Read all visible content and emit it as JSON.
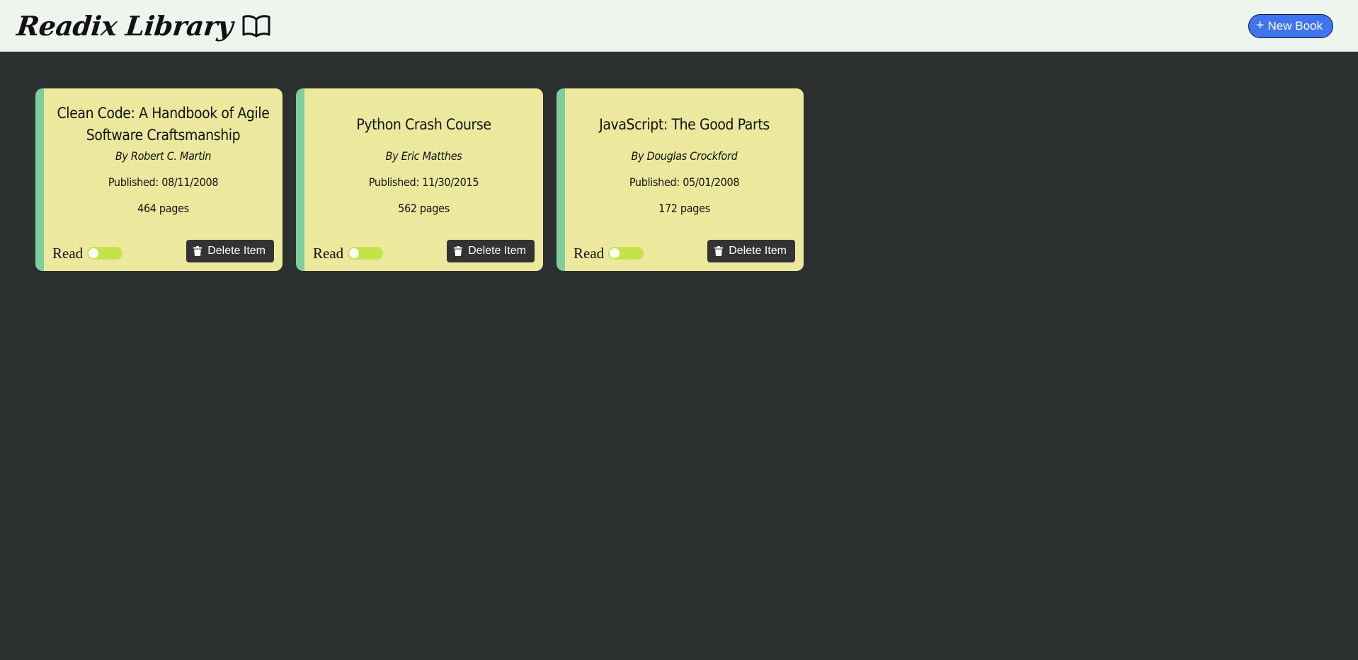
{
  "header": {
    "title": "Readix Library",
    "logo_icon": "open-book-icon",
    "new_book_label": "New Book",
    "new_book_icon": "plus-icon"
  },
  "colors": {
    "header_bg": "#eef5ee",
    "page_bg": "#2c3030",
    "card_bg": "#ece99e",
    "card_accent": "#7ecf9d",
    "toggle": "#c4e34a",
    "primary_button": "#3f74ee",
    "delete_button": "#333333"
  },
  "books": [
    {
      "title": "Clean Code: A Handbook of Agile Software Craftsmanship",
      "author": "By Robert C. Martin",
      "published": "Published: 08/11/2008",
      "pages": "464 pages",
      "read_label": "Read",
      "read": false,
      "delete_label": "Delete Item"
    },
    {
      "title": "Python Crash Course",
      "author": "By Eric Matthes",
      "published": "Published: 11/30/2015",
      "pages": "562 pages",
      "read_label": "Read",
      "read": false,
      "delete_label": "Delete Item"
    },
    {
      "title": "JavaScript: The Good Parts",
      "author": "By Douglas Crockford",
      "published": "Published: 05/01/2008",
      "pages": "172 pages",
      "read_label": "Read",
      "read": false,
      "delete_label": "Delete Item"
    }
  ]
}
